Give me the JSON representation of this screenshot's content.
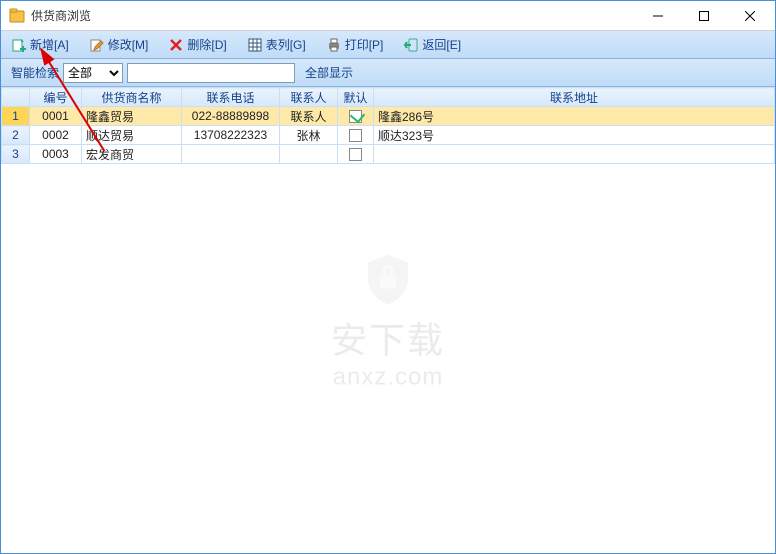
{
  "window": {
    "title": "供货商浏览"
  },
  "toolbar": {
    "add": "新增[A]",
    "edit": "修改[M]",
    "delete": "删除[D]",
    "columns": "表列[G]",
    "print": "打印[P]",
    "back": "返回[E]"
  },
  "filter": {
    "label": "智能检索",
    "dropdown_selected": "全部",
    "dropdown_options": [
      "全部"
    ],
    "search_value": "",
    "show_all": "全部显示"
  },
  "columns": {
    "id": "编号",
    "name": "供货商名称",
    "phone": "联系电话",
    "contact": "联系人",
    "default": "默认",
    "address": "联系地址"
  },
  "rows": [
    {
      "num": "1",
      "id": "0001",
      "name": "隆鑫贸易",
      "phone": "022-88889898",
      "contact": "联系人",
      "default": true,
      "address": "隆鑫286号",
      "selected": true
    },
    {
      "num": "2",
      "id": "0002",
      "name": "顺达贸易",
      "phone": "13708222323",
      "contact": "张林",
      "default": false,
      "address": "顺达323号",
      "selected": false
    },
    {
      "num": "3",
      "id": "0003",
      "name": "宏发商贸",
      "phone": "",
      "contact": "",
      "default": false,
      "address": "",
      "selected": false
    }
  ],
  "watermark": {
    "line1": "安下载",
    "line2": "anxz.com"
  }
}
